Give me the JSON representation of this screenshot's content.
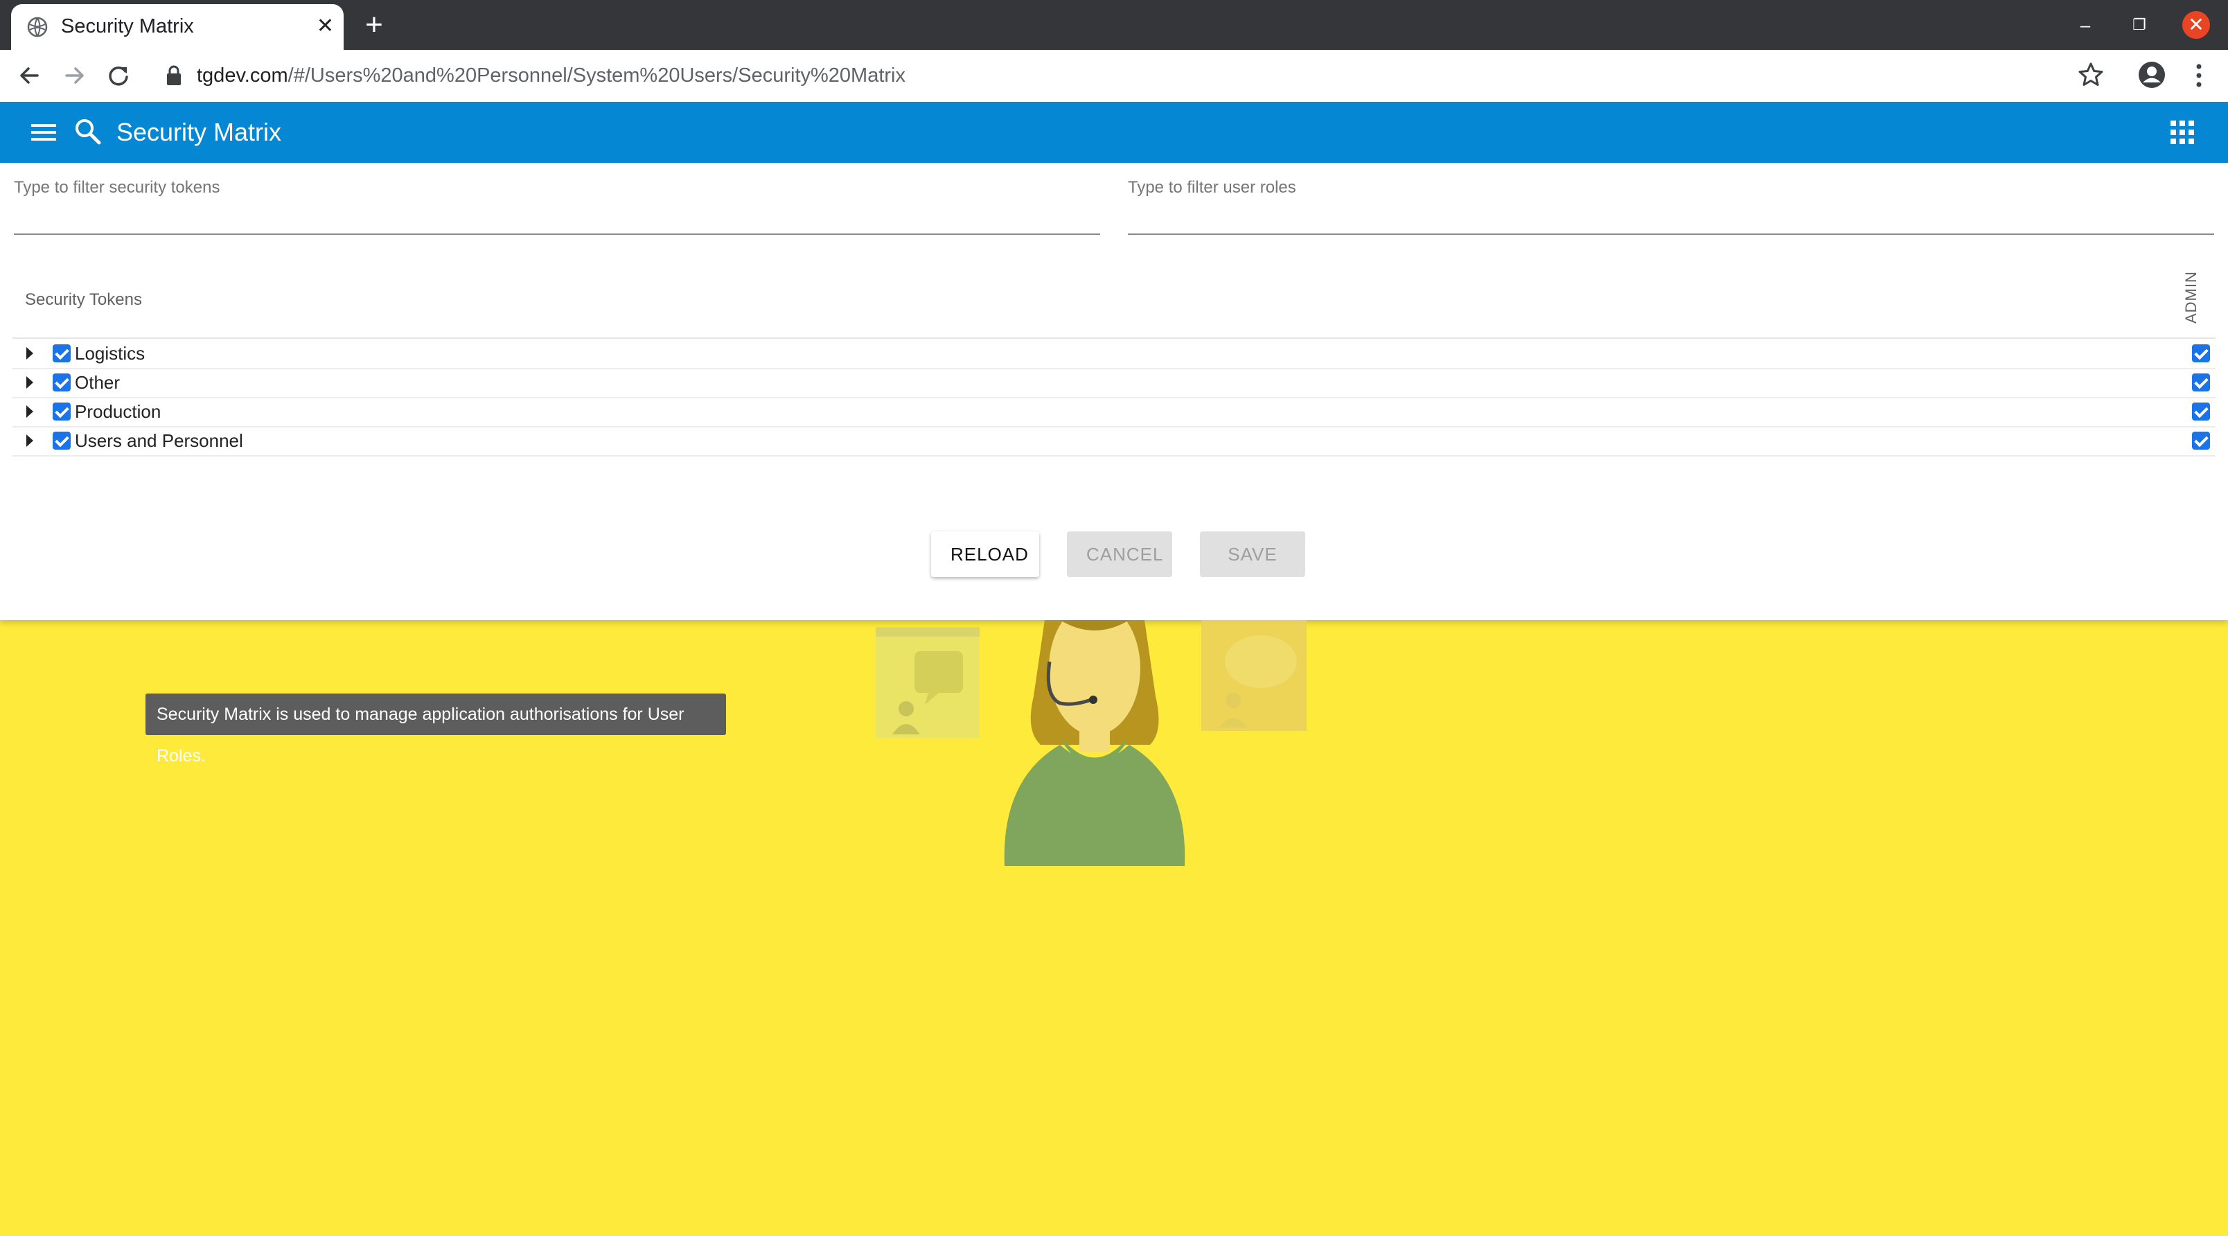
{
  "browser": {
    "tab_title": "Security Matrix",
    "url_host": "tgdev.com",
    "url_path": "/#/Users%20and%20Personnel/System%20Users/Security%20Matrix"
  },
  "appbar": {
    "title": "Security Matrix"
  },
  "filters": {
    "tokens_placeholder": "Type to filter security tokens",
    "roles_placeholder": "Type to filter user roles"
  },
  "matrix": {
    "tokens_header": "Security Tokens",
    "roles": [
      "ADMIN"
    ],
    "rows": [
      {
        "label": "Logistics",
        "checked": true,
        "admin": true
      },
      {
        "label": "Other",
        "checked": true,
        "admin": true
      },
      {
        "label": "Production",
        "checked": true,
        "admin": true
      },
      {
        "label": "Users and Personnel",
        "checked": true,
        "admin": true
      }
    ]
  },
  "actions": {
    "reload": "RELOAD",
    "cancel": "CANCEL",
    "save": "SAVE"
  },
  "tooltip": {
    "text": "Security Matrix is used to manage application authorisations for User Roles."
  },
  "colors": {
    "appbar": "#0687d4",
    "background": "#fdea3a",
    "checkbox": "#1a73e8"
  }
}
